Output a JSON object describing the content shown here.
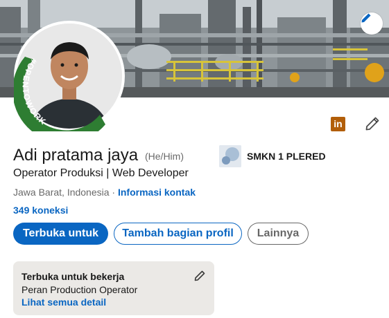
{
  "profile": {
    "name": "Adi pratama jaya",
    "pronouns": "(He/Him)",
    "headline": "Operator Produksi | Web Developer",
    "location": "Jawa Barat, Indonesia",
    "separator": " · ",
    "contact_link": "Informasi kontak",
    "connections": "349 koneksi",
    "open_to_work_badge": "#OPENTOWORK"
  },
  "education": {
    "school": "SMKN 1 PLERED"
  },
  "actions": {
    "open_to": "Terbuka untuk",
    "add_section": "Tambah bagian profil",
    "more": "Lainnya"
  },
  "open_to_work_card": {
    "title": "Terbuka untuk bekerja",
    "role": "Peran Production Operator",
    "details_link": "Lihat semua detail"
  },
  "colors": {
    "brand_blue": "#0a66c2",
    "otw_green": "#2e7d32",
    "linkedin_badge": "#b25e09"
  },
  "icons": {
    "cover_edit": "pencil-icon",
    "linkedin": "linkedin-icon",
    "profile_edit": "pencil-icon",
    "card_edit": "pencil-icon"
  }
}
